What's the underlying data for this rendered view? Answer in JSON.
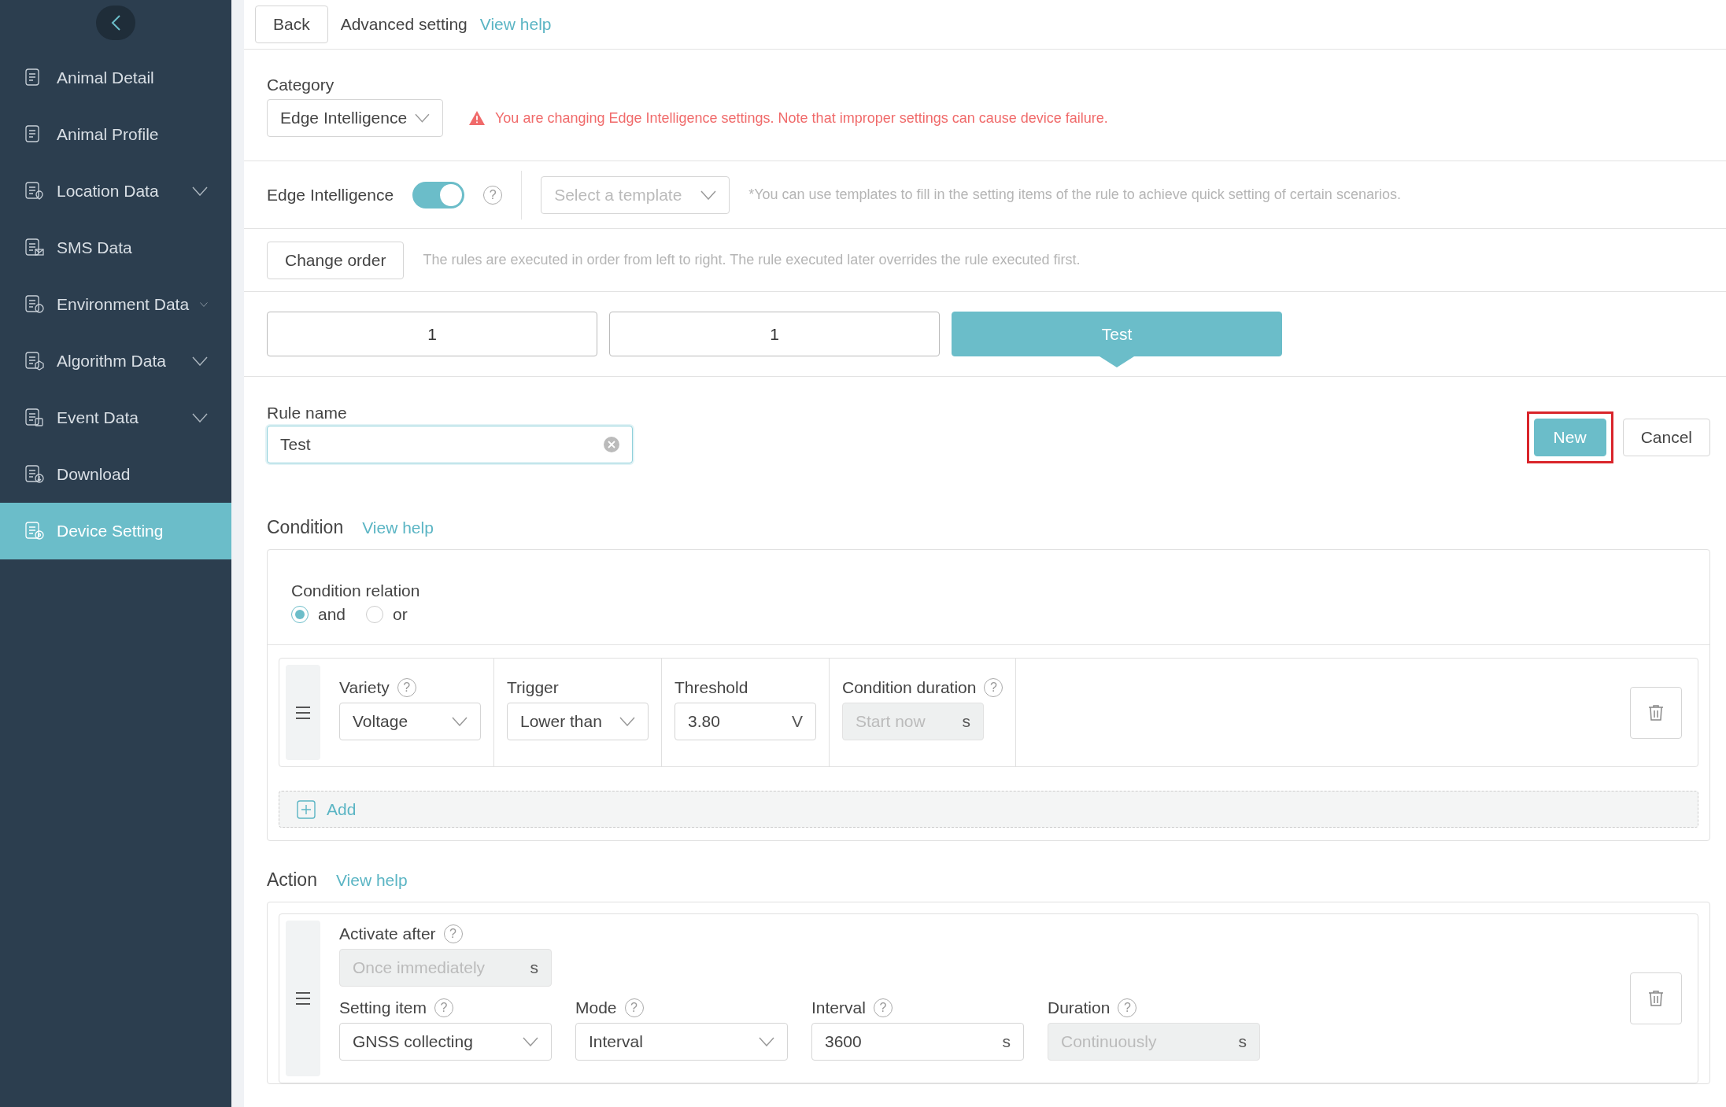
{
  "sidebar": {
    "items": [
      {
        "label": "Animal Detail",
        "expandable": false,
        "selected": false
      },
      {
        "label": "Animal Profile",
        "expandable": false,
        "selected": false
      },
      {
        "label": "Location Data",
        "expandable": true,
        "selected": false
      },
      {
        "label": "SMS Data",
        "expandable": false,
        "selected": false
      },
      {
        "label": "Environment Data",
        "expandable": true,
        "selected": false
      },
      {
        "label": "Algorithm Data",
        "expandable": true,
        "selected": false
      },
      {
        "label": "Event Data",
        "expandable": true,
        "selected": false
      },
      {
        "label": "Download",
        "expandable": false,
        "selected": false
      },
      {
        "label": "Device Setting",
        "expandable": false,
        "selected": true
      }
    ]
  },
  "topbar": {
    "back": "Back",
    "title": "Advanced setting",
    "help_link": "View help"
  },
  "category": {
    "label": "Category",
    "value": "Edge Intelligence",
    "warning": "You are changing Edge Intelligence settings. Note that improper settings can cause device failure."
  },
  "edge": {
    "label": "Edge Intelligence",
    "on": true,
    "help": "?",
    "template_placeholder": "Select a template",
    "hint": "*You can use templates to fill in the setting items of the rule to achieve quick setting of certain scenarios."
  },
  "order": {
    "button": "Change order",
    "hint": "The rules are executed in order from left to right. The rule executed later overrides the rule executed first."
  },
  "rules": [
    {
      "label": "1",
      "selected": false
    },
    {
      "label": "1",
      "selected": false
    },
    {
      "label": "Test",
      "selected": true
    }
  ],
  "rule_name": {
    "label": "Rule name",
    "value": "Test",
    "new_button": "New",
    "cancel_button": "Cancel",
    "new_highlighted": true
  },
  "condition": {
    "title": "Condition",
    "help_link": "View help",
    "relation_label": "Condition relation",
    "relations": [
      {
        "label": "and",
        "selected": true
      },
      {
        "label": "or",
        "selected": false
      }
    ],
    "fields": [
      {
        "label": "Variety",
        "help": "?",
        "kind": "select",
        "value": "Voltage",
        "disabled": false
      },
      {
        "label": "Trigger",
        "kind": "select",
        "value": "Lower than",
        "disabled": false
      },
      {
        "label": "Threshold",
        "kind": "input",
        "value": "3.80",
        "unit": "V",
        "disabled": false
      },
      {
        "label": "Condition duration",
        "help": "?",
        "kind": "input",
        "placeholder": "Start now",
        "unit": "s",
        "disabled": true
      }
    ],
    "add": "Add"
  },
  "action": {
    "title": "Action",
    "help_link": "View help",
    "activate": {
      "label": "Activate after",
      "help": "?",
      "kind": "input",
      "placeholder": "Once immediately",
      "unit": "s",
      "disabled": true
    },
    "fields": [
      {
        "label": "Setting item",
        "help": "?",
        "kind": "select",
        "value": "GNSS collecting",
        "disabled": false
      },
      {
        "label": "Mode",
        "help": "?",
        "kind": "select",
        "value": "Interval",
        "disabled": false
      },
      {
        "label": "Interval",
        "help": "?",
        "kind": "input",
        "value": "3600",
        "unit": "s",
        "disabled": false
      },
      {
        "label": "Duration",
        "help": "?",
        "kind": "input",
        "placeholder": "Continuously",
        "unit": "s",
        "disabled": true
      }
    ]
  }
}
